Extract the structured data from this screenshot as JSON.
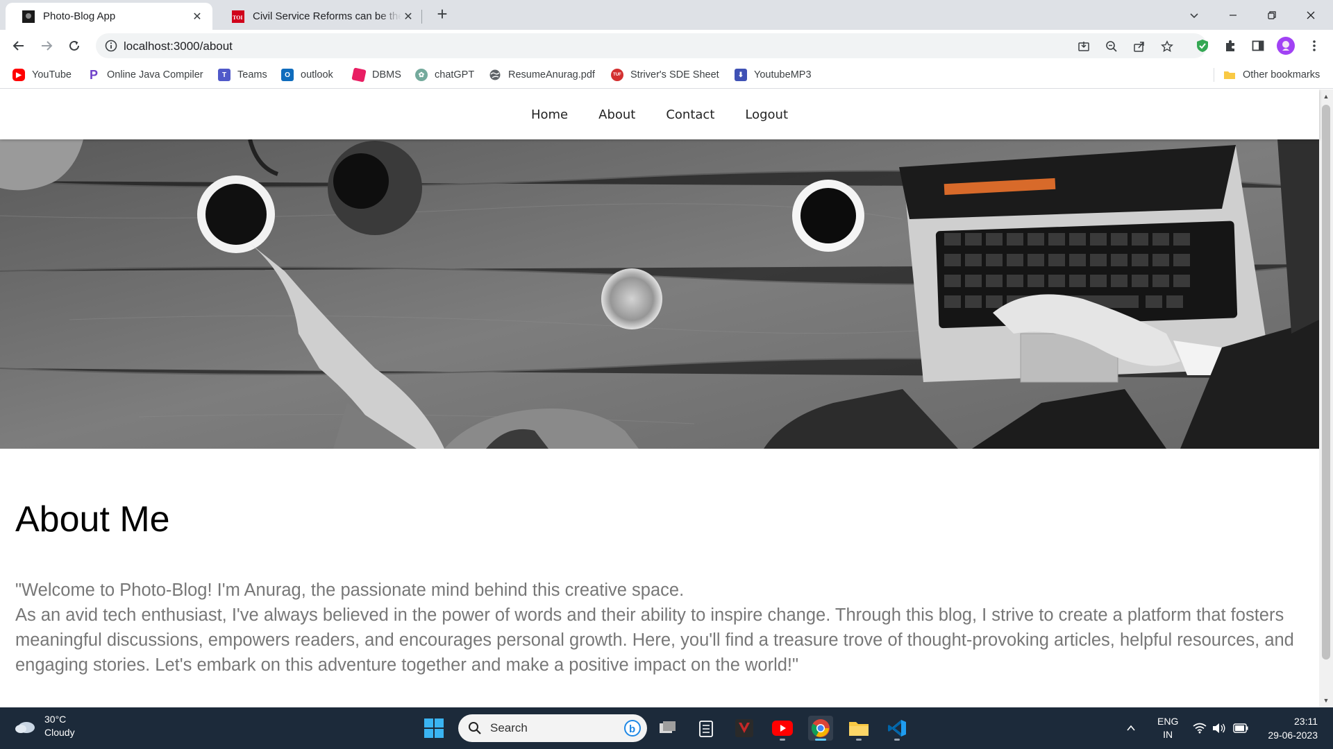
{
  "browser": {
    "tabs": [
      {
        "title": "Photo-Blog App",
        "active": true
      },
      {
        "title": "Civil Service Reforms can be the",
        "active": false
      }
    ],
    "url": "localhost:3000/about",
    "bookmarks": [
      {
        "label": "YouTube",
        "icon": "youtube-icon",
        "color": "#ff0000"
      },
      {
        "label": "Online Java Compiler",
        "icon": "java-compiler-icon",
        "color": "#6e40c9"
      },
      {
        "label": "Teams",
        "icon": "teams-icon",
        "color": "#5059c9"
      },
      {
        "label": "outlook",
        "icon": "outlook-icon",
        "color": "#0f6cbd"
      },
      {
        "label": "DBMS",
        "icon": "dbms-icon",
        "color": "#e91e63"
      },
      {
        "label": "chatGPT",
        "icon": "chatgpt-icon",
        "color": "#74aa9c"
      },
      {
        "label": "ResumeAnurag.pdf",
        "icon": "globe-icon",
        "color": "#5f6368"
      },
      {
        "label": "Striver's SDE Sheet",
        "icon": "striver-icon",
        "color": "#d32f2f"
      },
      {
        "label": "YoutubeMP3",
        "icon": "download-icon",
        "color": "#3f51b5"
      }
    ],
    "other_bookmarks": "Other bookmarks"
  },
  "site": {
    "nav": [
      "Home",
      "About",
      "Contact",
      "Logout"
    ],
    "about_title": "About Me",
    "about_line1": "\"Welcome to Photo-Blog! I'm Anurag, the passionate mind behind this creative space.",
    "about_line2": "As an avid tech enthusiast, I've always believed in the power of words and their ability to inspire change. Through this blog, I strive to create a platform that fosters meaningful discussions, empowers readers, and encourages personal growth. Here, you'll find a treasure trove of thought-provoking articles, helpful resources, and engaging stories. Let's embark on this adventure together and make a positive impact on the world!\"",
    "hero_image": "coffee-laptop-desk-photo"
  },
  "taskbar": {
    "weather_temp": "30°C",
    "weather_desc": "Cloudy",
    "search_placeholder": "Search",
    "lang_top": "ENG",
    "lang_bottom": "IN",
    "time": "23:11",
    "date": "29-06-2023"
  }
}
